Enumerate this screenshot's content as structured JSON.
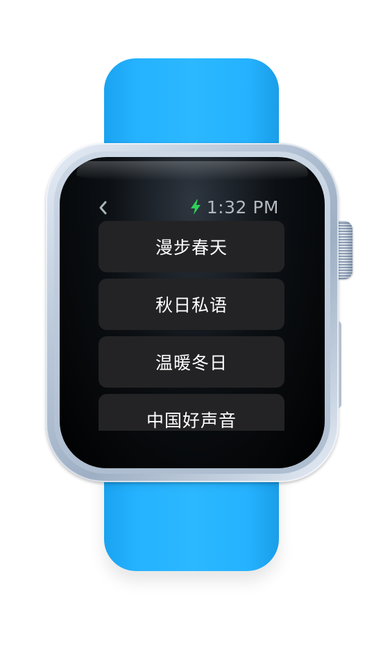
{
  "status_bar": {
    "back_icon": "chevron-left-icon",
    "charging_icon": "lightning-bolt-icon",
    "charging_color": "#2ed158",
    "time": "1:32 PM"
  },
  "list": {
    "items": [
      {
        "label": "漫步春天"
      },
      {
        "label": "秋日私语"
      },
      {
        "label": "温暖冬日"
      },
      {
        "label": "中国好声音"
      }
    ]
  },
  "device": {
    "band_color": "#2bb8ff",
    "case_color": "#bccadb"
  }
}
